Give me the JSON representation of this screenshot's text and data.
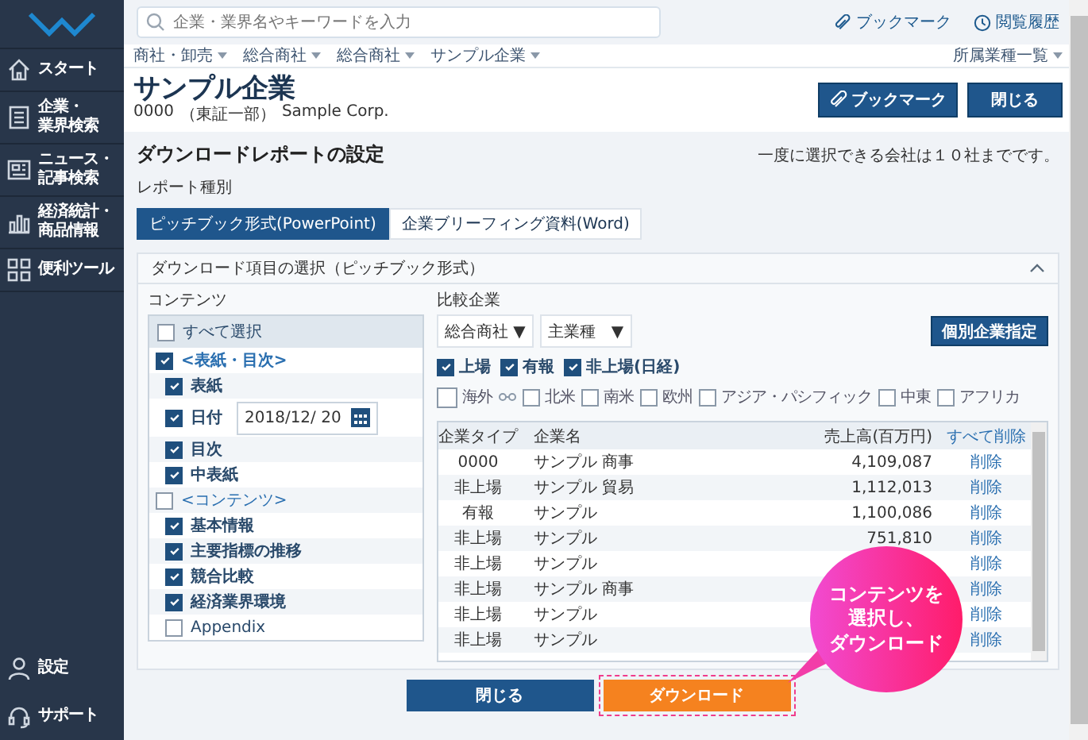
{
  "sidebar": {
    "items": [
      {
        "lines": [
          "スタート"
        ],
        "selected": false
      },
      {
        "lines": [
          "企業・",
          "業界検索"
        ],
        "selected": false
      },
      {
        "lines": [
          "ニュース・",
          "記事検索"
        ],
        "selected": false
      },
      {
        "lines": [
          "経済統計・",
          "商品情報"
        ],
        "selected": false
      },
      {
        "lines": [
          "便利ツール"
        ],
        "selected": false
      }
    ],
    "bottom_items": [
      "設定",
      "サポート"
    ]
  },
  "search": {
    "placeholder": "企業・業界名やキーワードを入力"
  },
  "top_links": [
    "ブックマーク",
    "閲覧履歴"
  ],
  "breadcrumb": [
    "商社・卸売",
    "総合商社",
    "総合商社",
    "サンプル企業"
  ],
  "industry_link": "所属業種一覧",
  "company": {
    "name": "サンプル企業",
    "code": "0000",
    "market": "（東証一部）",
    "english": "Sample Corp."
  },
  "header_buttons": [
    "ブックマーク",
    "閉じる"
  ],
  "section_title": "ダウンロードレポートの設定",
  "limit_note": "一度に選択できる会社は１０社までです。",
  "report_type_label": "レポート種別",
  "report_tabs": [
    {
      "label": "ピッチブック形式(PowerPoint)",
      "selected": true
    },
    {
      "label": "企業ブリーフィング資料(Word)",
      "selected": false
    }
  ],
  "panel": {
    "title": "ダウンロード項目の選択（ピッチブック形式）",
    "expanded": true
  },
  "contents_label": "コンテンツ",
  "select_all": {
    "label": "すべて選択",
    "checked": false
  },
  "content_items": [
    {
      "kind": "group",
      "label": "<表紙・目次>",
      "checked": true
    },
    {
      "kind": "item",
      "label": "表紙",
      "checked": true
    },
    {
      "kind": "date",
      "label": "日付",
      "checked": true,
      "value": "2018/12/ 20"
    },
    {
      "kind": "item",
      "label": "目次",
      "checked": true
    },
    {
      "kind": "item",
      "label": "中表紙",
      "checked": true
    },
    {
      "kind": "group",
      "label": "<コンテンツ>",
      "checked": false
    },
    {
      "kind": "item",
      "label": "基本情報",
      "checked": true
    },
    {
      "kind": "item",
      "label": "主要指標の推移",
      "checked": true
    },
    {
      "kind": "item",
      "label": "競合比較",
      "checked": true
    },
    {
      "kind": "item",
      "label": "経済業界環境",
      "checked": true
    },
    {
      "kind": "item",
      "label": "Appendix",
      "checked": false
    }
  ],
  "compare_label": "比較企業",
  "dropdowns": [
    "総合商社 ▼",
    "主業種　▼"
  ],
  "pick_button": "個別企業指定",
  "type_filters": [
    {
      "label": "上場",
      "checked": true
    },
    {
      "label": "有報",
      "checked": true
    },
    {
      "label": "非上場(日経)",
      "checked": true
    }
  ],
  "region_filters": [
    {
      "label": "海外",
      "checked": false
    },
    {
      "label": "北米",
      "checked": false
    },
    {
      "label": "南米",
      "checked": false
    },
    {
      "label": "欧州",
      "checked": false
    },
    {
      "label": "アジア・パシフィック",
      "checked": false
    },
    {
      "label": "中東",
      "checked": false
    },
    {
      "label": "アフリカ",
      "checked": false
    }
  ],
  "table": {
    "columns": [
      "企業タイプ",
      "企業名",
      "売上高(百万円)",
      "すべて削除"
    ],
    "rows": [
      {
        "type": "0000",
        "name": "サンプル 商事",
        "sales": "4,109,087",
        "action": "削除"
      },
      {
        "type": "非上場",
        "name": "サンプル 貿易",
        "sales": "1,112,013",
        "action": "削除"
      },
      {
        "type": "有報",
        "name": "サンプル",
        "sales": "1,100,086",
        "action": "削除"
      },
      {
        "type": "非上場",
        "name": "サンプル",
        "sales": "751,810",
        "action": "削除"
      },
      {
        "type": "非上場",
        "name": "サンプル",
        "action": "削除"
      },
      {
        "type": "非上場",
        "name": "サンプル 商事",
        "action": "削除"
      },
      {
        "type": "非上場",
        "name": "サンプル",
        "action": "削除"
      },
      {
        "type": "非上場",
        "name": "サンプル",
        "action": "削除"
      }
    ]
  },
  "footer_buttons": [
    {
      "label": "閉じる",
      "kind": "secondary"
    },
    {
      "label": "ダウンロード",
      "kind": "primary"
    }
  ],
  "callout": [
    "コンテンツを",
    "選択し、",
    "ダウンロード"
  ]
}
